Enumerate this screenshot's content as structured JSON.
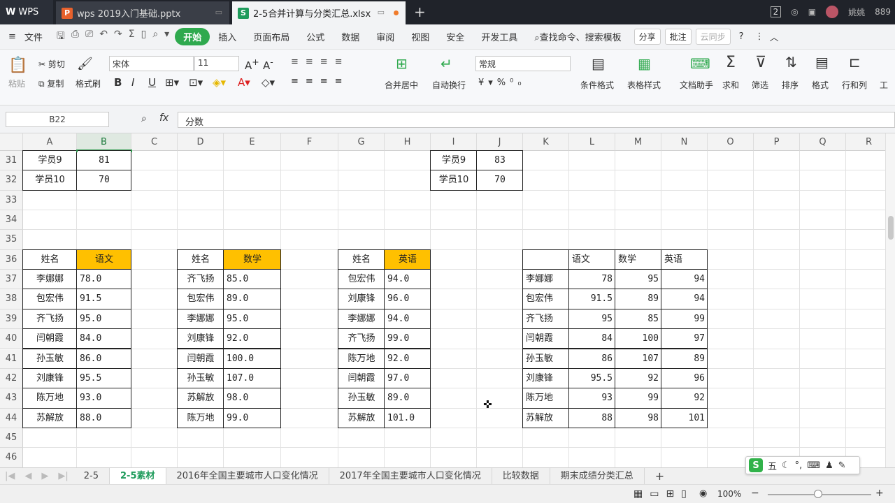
{
  "titlebar": {
    "app": "WPS",
    "tabs": [
      {
        "label": "wps 2019入门基础.pptx",
        "icon": "P"
      },
      {
        "label": "2-5合并计算与分类汇总.xlsx",
        "icon": "S"
      }
    ],
    "user": "姚姚",
    "user_id": "889",
    "badge": "2"
  },
  "menu": {
    "file": "文件",
    "tabs": [
      "开始",
      "插入",
      "页面布局",
      "公式",
      "数据",
      "审阅",
      "视图",
      "安全",
      "开发工具"
    ],
    "search": "查找命令、搜索模板",
    "share": "分享",
    "comment": "批注",
    "cloud": "云同步"
  },
  "ribbon": {
    "paste": "粘贴",
    "cut": "剪切",
    "copy": "复制",
    "format_painter": "格式刷",
    "font_name": "宋体",
    "font_size": "11",
    "merge_center": "合并居中",
    "wrap": "自动换行",
    "number_format": "常规",
    "cond_format": "条件格式",
    "table_style": "表格样式",
    "doc_helper": "文档助手",
    "sum": "求和",
    "filter": "筛选",
    "sort": "排序",
    "format": "格式",
    "rowcol": "行和列",
    "work": "工"
  },
  "formula_bar": {
    "name_box": "B22",
    "fx": "fx",
    "content": "分数"
  },
  "columns": [
    "A",
    "B",
    "C",
    "D",
    "E",
    "F",
    "G",
    "H",
    "I",
    "J",
    "K",
    "L",
    "M",
    "N",
    "O",
    "P",
    "Q",
    "R"
  ],
  "rows": [
    "31",
    "32",
    "33",
    "34",
    "35",
    "36",
    "37",
    "38",
    "39",
    "40",
    "41",
    "42",
    "43",
    "44",
    "45",
    "46"
  ],
  "top_left": [
    [
      "学员9",
      "81"
    ],
    [
      "学员10",
      "70"
    ]
  ],
  "top_right": [
    [
      "学员9",
      "83"
    ],
    [
      "学员10",
      "70"
    ]
  ],
  "table_chinese": {
    "headers": [
      "姓名",
      "语文"
    ],
    "rows": [
      [
        "李娜娜",
        "78.0"
      ],
      [
        "包宏伟",
        "91.5"
      ],
      [
        "齐飞扬",
        "95.0"
      ],
      [
        "闫朝霞",
        "84.0"
      ],
      [
        "孙玉敏",
        "86.0"
      ],
      [
        "刘康锋",
        "95.5"
      ],
      [
        "陈万地",
        "93.0"
      ],
      [
        "苏解放",
        "88.0"
      ]
    ]
  },
  "table_math": {
    "headers": [
      "姓名",
      "数学"
    ],
    "rows": [
      [
        "齐飞扬",
        "85.0"
      ],
      [
        "包宏伟",
        "89.0"
      ],
      [
        "李娜娜",
        "95.0"
      ],
      [
        "刘康锋",
        "92.0"
      ],
      [
        "闫朝霞",
        "100.0"
      ],
      [
        "孙玉敏",
        "107.0"
      ],
      [
        "苏解放",
        "98.0"
      ],
      [
        "陈万地",
        "99.0"
      ]
    ]
  },
  "table_english": {
    "headers": [
      "姓名",
      "英语"
    ],
    "rows": [
      [
        "包宏伟",
        "94.0"
      ],
      [
        "刘康锋",
        "96.0"
      ],
      [
        "李娜娜",
        "94.0"
      ],
      [
        "齐飞扬",
        "99.0"
      ],
      [
        "陈万地",
        "92.0"
      ],
      [
        "闫朝霞",
        "97.0"
      ],
      [
        "孙玉敏",
        "89.0"
      ],
      [
        "苏解放",
        "101.0"
      ]
    ]
  },
  "table_merged": {
    "headers": [
      "",
      "语文",
      "数学",
      "英语"
    ],
    "rows": [
      [
        "李娜娜",
        "78",
        "95",
        "94"
      ],
      [
        "包宏伟",
        "91.5",
        "89",
        "94"
      ],
      [
        "齐飞扬",
        "95",
        "85",
        "99"
      ],
      [
        "闫朝霞",
        "84",
        "100",
        "97"
      ],
      [
        "孙玉敏",
        "86",
        "107",
        "89"
      ],
      [
        "刘康锋",
        "95.5",
        "92",
        "96"
      ],
      [
        "陈万地",
        "93",
        "99",
        "92"
      ],
      [
        "苏解放",
        "88",
        "98",
        "101"
      ]
    ]
  },
  "sheets": [
    "2-5",
    "2-5素材",
    "2016年全国主要城市人口变化情况",
    "2017年全国主要城市人口变化情况",
    "比较数据",
    "期末成绩分类汇总"
  ],
  "active_sheet": "2-5素材",
  "status": {
    "zoom": "100%"
  },
  "ime": {
    "label": "五"
  },
  "colors": {
    "accent": "#2fa94e",
    "header_fill": "#ffc000"
  }
}
